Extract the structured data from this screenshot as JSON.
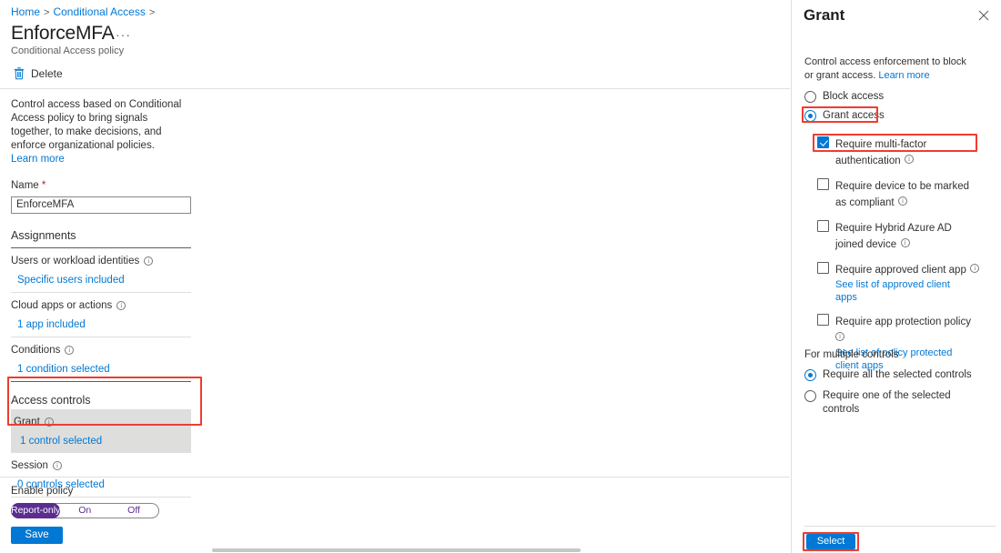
{
  "breadcrumb": {
    "items": [
      "Home",
      "Conditional Access"
    ],
    "separator": ">"
  },
  "header": {
    "title": "EnforceMFA",
    "ellipsis": "···",
    "subtitle": "Conditional Access policy"
  },
  "commandbar": {
    "delete_label": "Delete",
    "delete_icon": "trash-icon"
  },
  "main": {
    "description": "Control access based on Conditional Access policy to bring signals together, to make decisions, and enforce organizational policies.",
    "learn_more": "Learn more",
    "name_label": "Name",
    "name_required_marker": "*",
    "name_value": "EnforceMFA",
    "assignments_heading": "Assignments",
    "assignment_groups": [
      {
        "title": "Users or workload identities",
        "value": "Specific users included",
        "info_icon": "info-icon"
      },
      {
        "title": "Cloud apps or actions",
        "value": "1 app included",
        "info_icon": "info-icon"
      },
      {
        "title": "Conditions",
        "value": "1 condition selected",
        "info_icon": "info-icon"
      }
    ],
    "access_controls_heading": "Access controls",
    "control_groups": [
      {
        "title": "Grant",
        "value": "1 control selected",
        "info_icon": "info-icon",
        "selected": true
      },
      {
        "title": "Session",
        "value": "0 controls selected",
        "info_icon": "info-icon",
        "selected": false
      }
    ],
    "enable_policy_label": "Enable policy",
    "enable_policy_options": [
      "Report-only",
      "On",
      "Off"
    ],
    "enable_policy_selected": "Report-only",
    "save_label": "Save"
  },
  "grant_panel": {
    "title": "Grant",
    "close_icon": "close-icon",
    "intro_text": "Control access enforcement to block or grant access.",
    "intro_link": "Learn more",
    "access_mode_options": [
      {
        "label": "Block access",
        "checked": false
      },
      {
        "label": "Grant access",
        "checked": true
      }
    ],
    "controls": [
      {
        "label": "Require multi-factor authentication",
        "checked": true,
        "info_icon": "info-icon",
        "sub_link": ""
      },
      {
        "label": "Require device to be marked as compliant",
        "checked": false,
        "info_icon": "info-icon",
        "sub_link": ""
      },
      {
        "label": "Require Hybrid Azure AD joined device",
        "checked": false,
        "info_icon": "info-icon",
        "sub_link": ""
      },
      {
        "label": "Require approved client app",
        "checked": false,
        "info_icon": "info-icon",
        "sub_link": "See list of approved client apps"
      },
      {
        "label": "Require app protection policy",
        "checked": false,
        "info_icon": "info-icon",
        "sub_link": "See list of policy protected client apps"
      }
    ],
    "multiple_controls_heading": "For multiple controls",
    "multiple_controls_options": [
      {
        "label": "Require all the selected controls",
        "checked": true
      },
      {
        "label": "Require one of the selected controls",
        "checked": false
      }
    ],
    "select_label": "Select"
  },
  "colors": {
    "accent_blue": "#0078d4",
    "link_blue": "#0078d4",
    "annotation_red": "#f03c2e",
    "report_only_purple": "#5c2d91",
    "selected_row_gray": "#dededd"
  }
}
